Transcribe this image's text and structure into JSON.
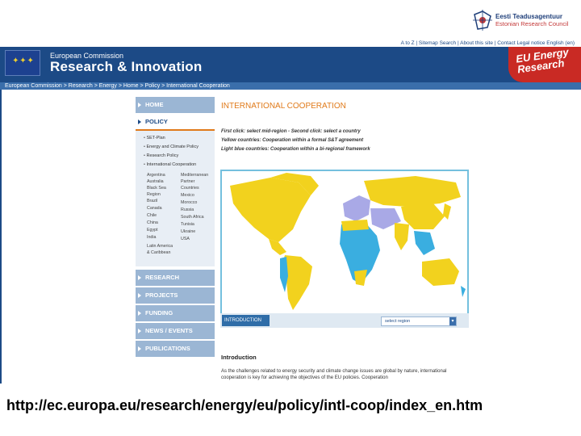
{
  "slide_logo": {
    "name": "Eesti Teadusagentuur",
    "sub": "Estonian Research Council"
  },
  "ec_header": {
    "top_links": "A to Z | Sitemap  Search | About this site | Contact  Legal notice  English (en)",
    "org": "European Commission",
    "title": "Research & Innovation",
    "badge_line1": "EU Energy",
    "badge_line2": "Research",
    "breadcrumb": "European Commission  >  Research  >  Energy  >  Home  >  Policy  >  International Cooperation"
  },
  "nav": {
    "home": "HOME",
    "policy": "POLICY",
    "policy_sub": [
      "SET-Plan",
      "Energy and Climate Policy",
      "Research Policy",
      "International Cooperation"
    ],
    "countries_left": [
      "Argentina",
      "Australia",
      "Black Sea",
      "Region",
      "Brazil",
      "Canada",
      "Chile",
      "China",
      "Egypt",
      "India",
      "Latin America",
      "& Caribbean"
    ],
    "countries_right": [
      "Mediterranean",
      "Partner",
      "Countries",
      "Mexico",
      "Morocco",
      "Russia",
      "South Africa",
      "Tunisia",
      "Ukraine",
      "USA"
    ],
    "research": "RESEARCH",
    "projects": "PROJECTS",
    "funding": "FUNDING",
    "news": "NEWS / EVENTS",
    "publications": "PUBLICATIONS"
  },
  "main": {
    "title": "INTERNATIONAL COOPERATION",
    "legend_1": "First click: select mid-region - Second click: select a country",
    "legend_2": "Yellow countries: Cooperation within a formal S&T agreement",
    "legend_3": "Light blue countries: Cooperation within a bi-regional framework",
    "intro_tab": "INTRODUCTION",
    "select_region": "select region",
    "intro_heading": "Introduction",
    "intro_body": "As the challenges related to energy security and climate change issues are global by nature, international cooperation is key for achieving the objectives of the EU policies. Cooperation"
  },
  "url_caption": "http://ec.europa.eu/research/energy/eu/policy/intl-coop/index_en.htm",
  "colors": {
    "ec_blue": "#1c4a86",
    "accent_orange": "#e07a1a",
    "map_yellow": "#f2d21e",
    "map_lightblue": "#3aaee0",
    "map_lavender": "#a9a9e6"
  }
}
